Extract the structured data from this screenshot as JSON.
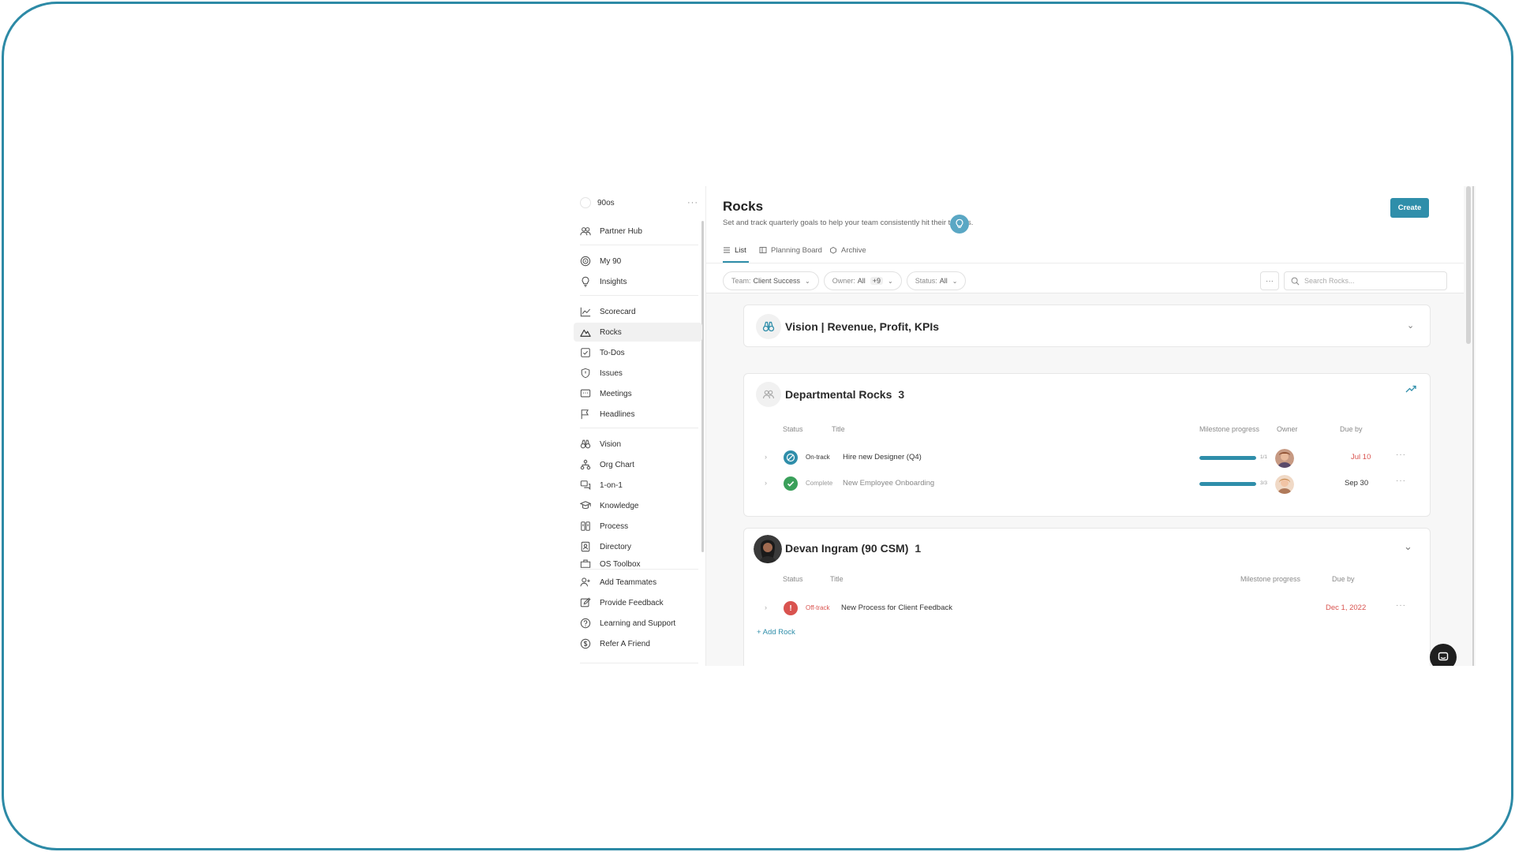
{
  "workspace": {
    "name": "90os",
    "more": "···"
  },
  "sidebar": {
    "items": [
      {
        "label": "Partner Hub",
        "icon": "partner-hub-icon"
      },
      {
        "label": "My 90",
        "icon": "target-icon"
      },
      {
        "label": "Insights",
        "icon": "lightbulb-icon"
      },
      {
        "label": "Scorecard",
        "icon": "chart-line-icon"
      },
      {
        "label": "Rocks",
        "icon": "mountain-icon"
      },
      {
        "label": "To-Dos",
        "icon": "checkbox-icon"
      },
      {
        "label": "Issues",
        "icon": "shield-icon"
      },
      {
        "label": "Meetings",
        "icon": "meetings-icon"
      },
      {
        "label": "Headlines",
        "icon": "flag-icon"
      },
      {
        "label": "Vision",
        "icon": "binoculars-icon"
      },
      {
        "label": "Org Chart",
        "icon": "org-chart-icon"
      },
      {
        "label": "1-on-1",
        "icon": "chat-bubbles-icon"
      },
      {
        "label": "Knowledge",
        "icon": "knowledge-icon"
      },
      {
        "label": "Process",
        "icon": "process-icon"
      },
      {
        "label": "Directory",
        "icon": "directory-icon"
      },
      {
        "label": "OS Toolbox",
        "icon": "toolbox-icon"
      }
    ],
    "footer": [
      {
        "label": "Add Teammates",
        "icon": "add-user-icon"
      },
      {
        "label": "Provide Feedback",
        "icon": "edit-icon"
      },
      {
        "label": "Learning and Support",
        "icon": "help-circle-icon"
      },
      {
        "label": "Refer A Friend",
        "icon": "dollar-circle-icon"
      }
    ]
  },
  "header": {
    "title": "Rocks",
    "subtitle": "Set and track quarterly goals to help your team consistently hit their targets.",
    "create_label": "Create",
    "tabs": [
      {
        "label": "List"
      },
      {
        "label": "Planning Board"
      },
      {
        "label": "Archive"
      }
    ]
  },
  "filters": {
    "team_label": "Team:",
    "team_value": "Client Success",
    "owner_label": "Owner:",
    "owner_value": "All",
    "owner_extra": "+9",
    "status_label": "Status:",
    "status_value": "All",
    "more": "···",
    "search_placeholder": "Search Rocks..."
  },
  "vision_card": {
    "title": "Vision | Revenue, Profit, KPIs"
  },
  "dept_card": {
    "title": "Departmental Rocks",
    "count": "3",
    "columns": {
      "status": "Status",
      "title": "Title",
      "milestone": "Milestone progress",
      "owner": "Owner",
      "due": "Due by"
    },
    "rows": [
      {
        "status": "On-track",
        "title": "Hire new Designer (Q4)",
        "progress": 1.0,
        "progress_label": "1/1",
        "due": "Jul 10",
        "status_color": "#2f8eaa",
        "due_color": "#d9534f"
      },
      {
        "status": "Complete",
        "title": "New Employee Onboarding",
        "progress": 1.0,
        "progress_label": "3/3",
        "due": "Sep 30",
        "status_color": "#3aa05a",
        "due_color": "#333333"
      }
    ]
  },
  "person_card": {
    "title": "Devan Ingram (90 CSM)",
    "count": "1",
    "columns": {
      "status": "Status",
      "title": "Title",
      "milestone": "Milestone progress",
      "due": "Due by"
    },
    "rows": [
      {
        "status": "Off-track",
        "title": "New Process for Client Feedback",
        "due": "Dec 1, 2022",
        "status_color": "#d9534f",
        "due_color": "#d9534f"
      }
    ],
    "add_label": "+ Add Rock"
  }
}
